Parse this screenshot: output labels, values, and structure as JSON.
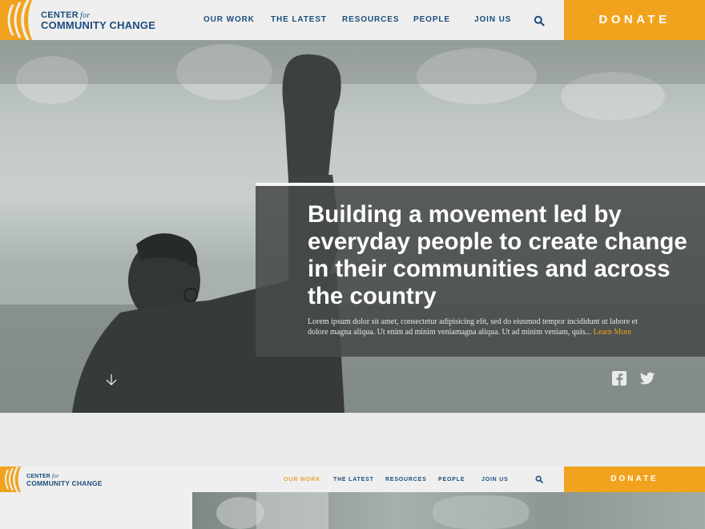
{
  "brand": {
    "line1": "CENTER",
    "for": "for",
    "line2": "COMMUNITY CHANGE"
  },
  "nav": {
    "items": [
      "OUR WORK",
      "THE LATEST",
      "RESOURCES",
      "PEOPLE",
      "JOIN US"
    ],
    "donate": "DONATE"
  },
  "hero": {
    "title": "Building a movement led by everyday people to create change in their communities and across the country",
    "body": "Lorem ipsum dolor sit amet, consectetur adipisicing elit, sed do eiusmod tempor incididunt ut labore et dolore magna aliqua. Ut enim ad minim veniamagna aliqua. Ut  ad minim veniam, quis...",
    "more": "Learn More"
  },
  "nav2": {
    "items": [
      "OUR WORK",
      "THE LATEST",
      "RESOURCES",
      "PEOPLE",
      "JOIN US"
    ],
    "active_index": 0,
    "donate": "DONATE"
  },
  "colors": {
    "accent": "#f2a31e",
    "brand_blue": "#1d4d7c",
    "panel": "#474a49"
  },
  "icons": [
    "logo-arcs-icon",
    "search-icon",
    "arrow-down-icon",
    "facebook-icon",
    "twitter-icon"
  ]
}
